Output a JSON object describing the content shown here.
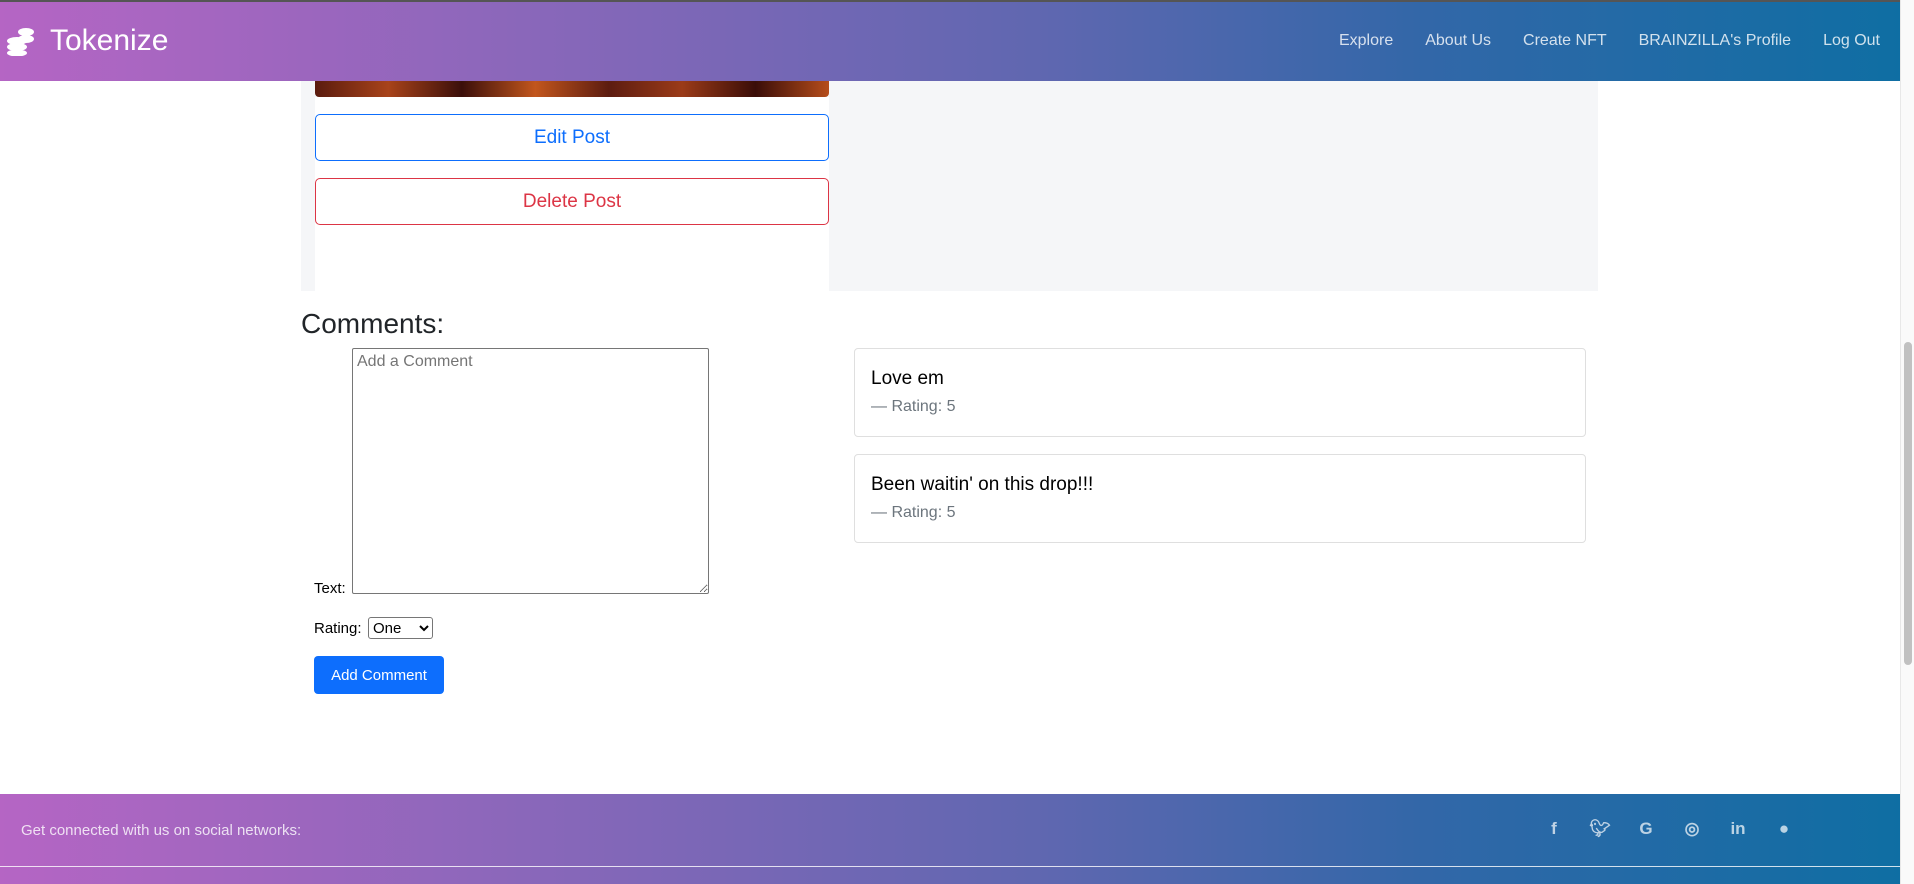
{
  "navbar": {
    "brand": "Tokenize",
    "links": [
      "Explore",
      "About Us",
      "Create NFT",
      "BRAINZILLA's Profile",
      "Log Out"
    ]
  },
  "post": {
    "edit_label": "Edit Post",
    "delete_label": "Delete Post"
  },
  "comments": {
    "heading": "Comments:",
    "form": {
      "text_label": "Text:",
      "placeholder": "Add a Comment",
      "rating_label": "Rating:",
      "rating_value": "One",
      "submit_label": "Add Comment"
    },
    "items": [
      {
        "text": "Love em",
        "rating": "— Rating: 5"
      },
      {
        "text": "Been waitin' on this drop!!!",
        "rating": "— Rating: 5"
      }
    ]
  },
  "footer": {
    "text": "Get connected with us on social networks:",
    "icons": [
      "facebook-icon",
      "twitter-icon",
      "google-icon",
      "instagram-icon",
      "linkedin-icon",
      "github-icon"
    ]
  }
}
